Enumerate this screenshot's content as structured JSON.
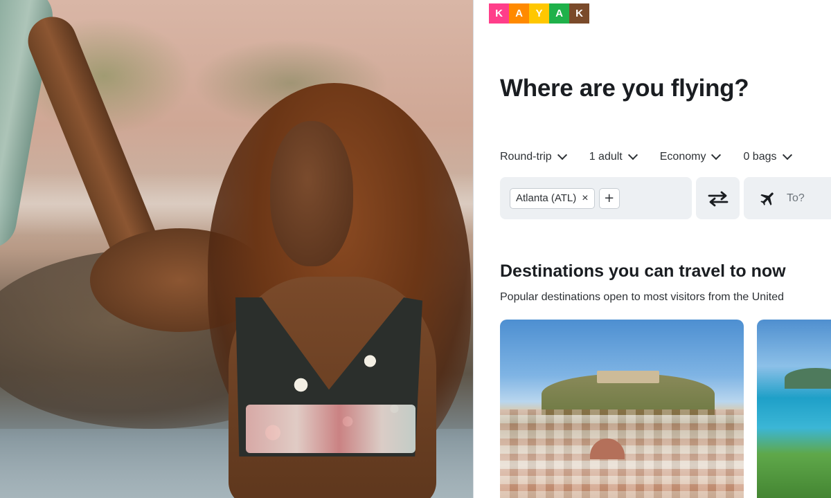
{
  "brand": {
    "letters": [
      "K",
      "A",
      "Y",
      "A",
      "K"
    ],
    "tile_colors": [
      "#ff3e8a",
      "#ff8a00",
      "#ffc700",
      "#1fb14a",
      "#7a4a2a"
    ]
  },
  "headline": "Where are you flying?",
  "trip_options": {
    "trip_type": "Round-trip",
    "travelers": "1 adult",
    "cabin": "Economy",
    "bags": "0 bags"
  },
  "search": {
    "origin_chip": "Atlanta (ATL)",
    "remove_symbol": "×",
    "add_symbol": "+",
    "destination_placeholder": "To?"
  },
  "destinations": {
    "title": "Destinations you can travel to now",
    "subtitle": "Popular destinations open to most visitors from the United"
  },
  "icons": {
    "swap": "swap-arrows-icon",
    "plane": "airplane-icon",
    "chevron": "chevron-down-icon"
  }
}
